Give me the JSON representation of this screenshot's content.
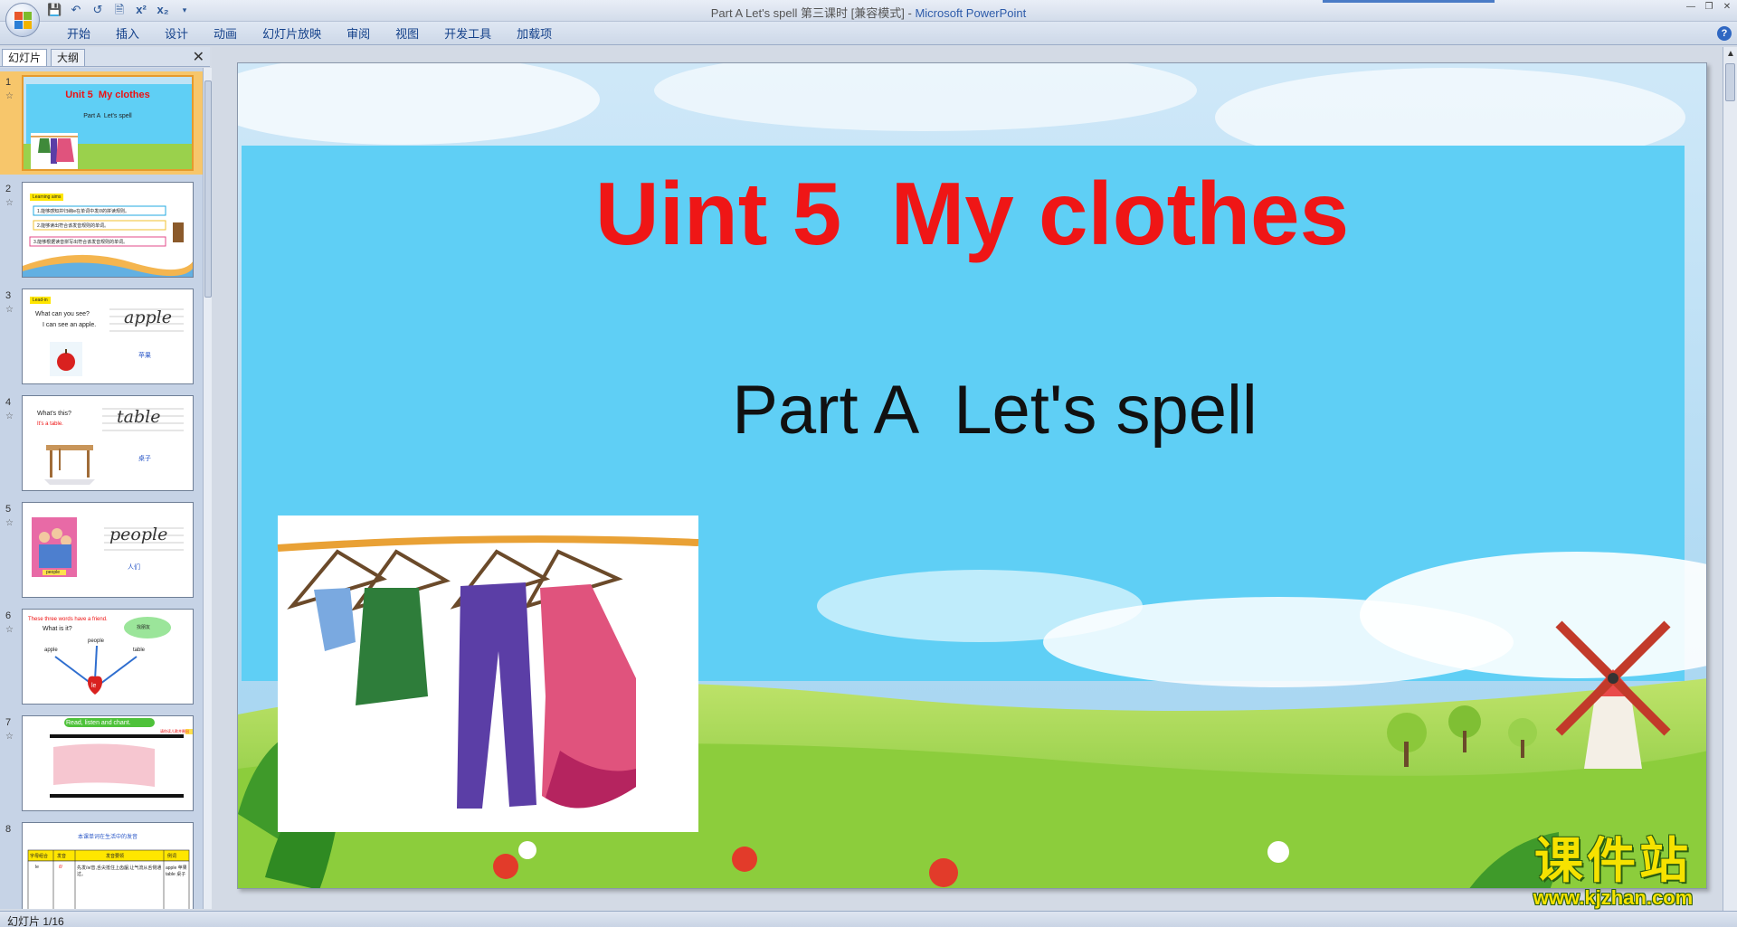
{
  "window": {
    "title_prefix": "Part A Let's spell 第三课时 [兼容模式] - ",
    "title_app": "Microsoft PowerPoint"
  },
  "ribbon": {
    "tabs": [
      "开始",
      "插入",
      "设计",
      "动画",
      "幻灯片放映",
      "审阅",
      "视图",
      "开发工具",
      "加载项"
    ]
  },
  "pane": {
    "tab_slides": "幻灯片",
    "tab_outline": "大纲"
  },
  "thumbnails": [
    {
      "num": "1",
      "title": "Unit 5  My clothes",
      "sub": "Part A  Let's spell"
    },
    {
      "num": "2",
      "tag": "Learning aims",
      "lines": [
        "1.能够感知并归纳le在单词中发/l/的拼读规则。",
        "2.能够读出符合该发音规则的单词。",
        "3.能够根据读音拼写出符合该发音规则的单词。"
      ]
    },
    {
      "num": "3",
      "tag": "Lead-in",
      "q": "What can you see?",
      "a": "I can see an apple.",
      "word": "apple",
      "cn": "苹果"
    },
    {
      "num": "4",
      "q": "What's this?",
      "a": "It's a table.",
      "word": "table",
      "cn": "桌子"
    },
    {
      "num": "5",
      "word": "people",
      "cn": "人们",
      "pic_label": "people"
    },
    {
      "num": "6",
      "heading": "These three words have a friend.",
      "q": "What is it?",
      "words": [
        "apple",
        "people",
        "table"
      ],
      "le": "le",
      "bubble": "找朋友"
    },
    {
      "num": "7",
      "heading": "Read, listen and chant.",
      "note": "请你读儿歌并圈出"
    },
    {
      "num": "8",
      "heading": "本课单词在生活中的发音",
      "cols": [
        "字母组合",
        "发音",
        "发音要领",
        "例词"
      ],
      "cells": [
        "le",
        "/l/",
        "先发/ə/音,舌尖抵住上齿龈,让气流从舌侧通过。",
        "apple 苹果 table 桌子"
      ]
    }
  ],
  "slide": {
    "title": "Uint 5  My clothes",
    "subtitle": "Part A  Let's spell"
  },
  "status": {
    "slide_counter": "幻灯片 1/16"
  },
  "watermark": {
    "name": "课件站",
    "url": "www.kjzhan.com"
  },
  "colors": {
    "title_red": "#ef1616",
    "sky_blue": "#5fcff5",
    "ribbon_blue": "#15428b"
  }
}
